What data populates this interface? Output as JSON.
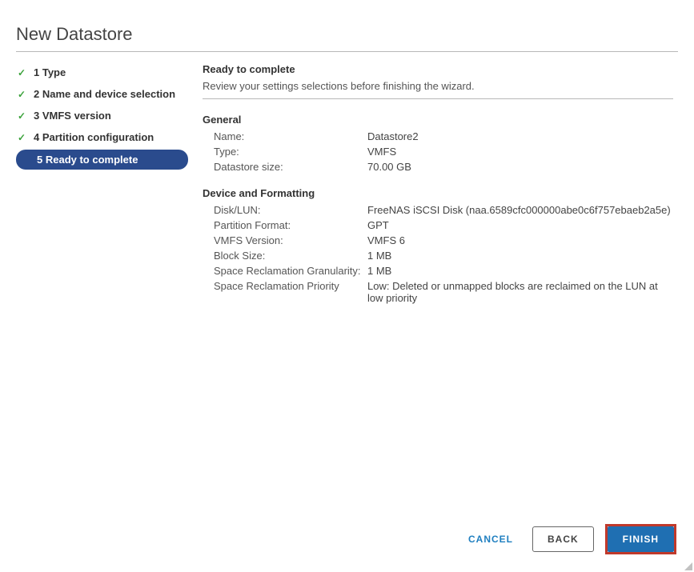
{
  "title": "New Datastore",
  "steps": {
    "s1": "1 Type",
    "s2": "2 Name and device selection",
    "s3": "3 VMFS version",
    "s4": "4 Partition configuration",
    "s5": "5 Ready to complete"
  },
  "main": {
    "heading": "Ready to complete",
    "subheading": "Review your settings selections before finishing the wizard."
  },
  "general": {
    "section": "General",
    "name_label": "Name:",
    "name_value": "Datastore2",
    "type_label": "Type:",
    "type_value": "VMFS",
    "size_label": "Datastore size:",
    "size_value": "70.00 GB"
  },
  "device": {
    "section": "Device and Formatting",
    "disk_label": "Disk/LUN:",
    "disk_value": "FreeNAS iSCSI Disk (naa.6589cfc000000abe0c6f757ebaeb2a5e)",
    "partfmt_label": "Partition Format:",
    "partfmt_value": "GPT",
    "vmfsver_label": "VMFS Version:",
    "vmfsver_value": "VMFS 6",
    "block_label": "Block Size:",
    "block_value": "1 MB",
    "granularity_label": "Space Reclamation Granularity:",
    "granularity_value": "1 MB",
    "priority_label": "Space Reclamation Priority",
    "priority_value": "Low: Deleted or unmapped blocks are reclaimed on the LUN at low priority"
  },
  "footer": {
    "cancel": "CANCEL",
    "back": "BACK",
    "finish": "FINISH"
  }
}
